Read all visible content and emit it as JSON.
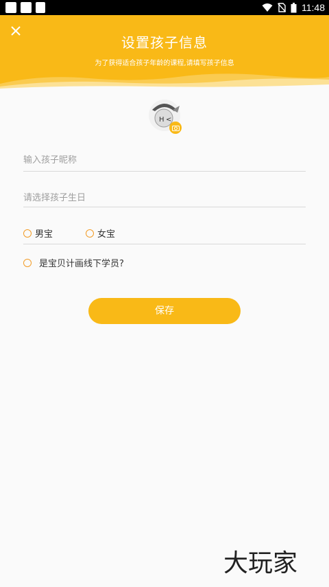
{
  "status_bar": {
    "time": "11:48",
    "icons": [
      "wifi-icon",
      "no-sim-icon",
      "battery-icon"
    ]
  },
  "header": {
    "title": "设置孩子信息",
    "subtitle": "为了获得适合孩子年龄的课程,请填写孩子信息",
    "close_icon": "close-icon",
    "background_color": "#f9b917"
  },
  "avatar": {
    "badge_icon": "camera-icon"
  },
  "form": {
    "nickname_placeholder": "输入孩子昵称",
    "nickname_value": "",
    "birthday_placeholder": "请选择孩子生日",
    "gender_options": [
      "男宝",
      "女宝"
    ],
    "member_question": "是宝贝计画线下学员?",
    "save_label": "保存"
  },
  "watermark": {
    "text": "大玩家"
  },
  "colors": {
    "accent": "#f9b917",
    "radio_border": "#f29b25",
    "divider": "#d8d8d8"
  }
}
